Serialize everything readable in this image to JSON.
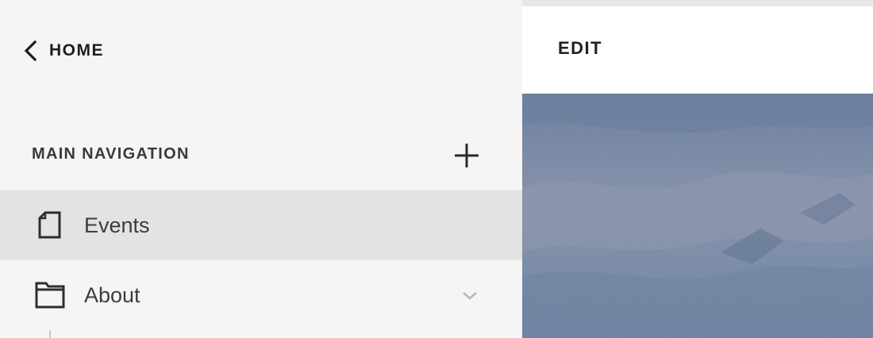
{
  "back": {
    "label": "HOME",
    "icon": "chevron-left-icon"
  },
  "navigation": {
    "title": "MAIN NAVIGATION",
    "add_icon": "plus-icon",
    "items": [
      {
        "label": "Events",
        "icon": "page-icon",
        "selected": true
      },
      {
        "label": "About",
        "icon": "folder-icon",
        "selected": false,
        "expand_icon": "chevron-down-icon"
      }
    ]
  },
  "preview": {
    "edit_label": "EDIT",
    "image_description": "landscape photo (blue-grey hillside)"
  },
  "colors": {
    "sidebar_bg": "#f5f5f5",
    "selected_bg": "#e3e3e3",
    "preview_header_bg": "#ffffff",
    "text_dark": "#1e1e1e"
  }
}
